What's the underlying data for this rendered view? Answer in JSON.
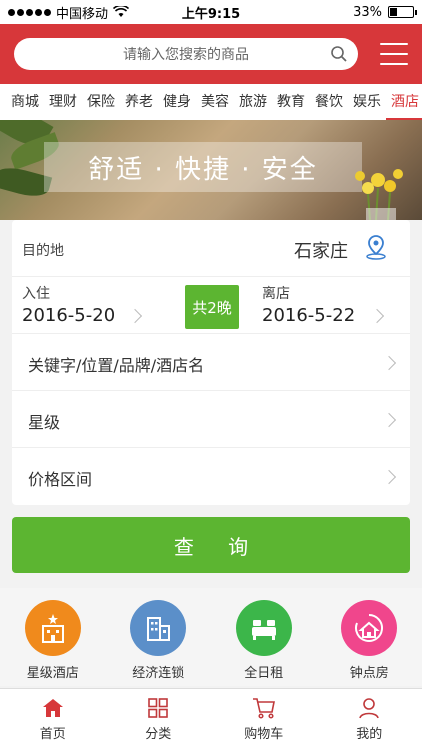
{
  "status": {
    "carrier": "中国移动",
    "time": "上午9:15",
    "battery": "33%"
  },
  "header": {
    "search_placeholder": "请输入您搜索的商品"
  },
  "categories": [
    "商城",
    "理财",
    "保险",
    "养老",
    "健身",
    "美容",
    "旅游",
    "教育",
    "餐饮",
    "娱乐",
    "酒店"
  ],
  "active_category": "酒店",
  "banner": {
    "title": "舒适 · 快捷 · 安全"
  },
  "form": {
    "destination_label": "目的地",
    "destination_value": "石家庄",
    "checkin_label": "入住",
    "checkin_date": "2016-5-20",
    "nights": "共2晚",
    "checkout_label": "离店",
    "checkout_date": "2016-5-22",
    "keyword_label": "关键字/位置/品牌/酒店名",
    "star_label": "星级",
    "price_label": "价格区间"
  },
  "query_button": "查 询",
  "quick": [
    {
      "label": "星级酒店",
      "icon": "hotel-building-icon",
      "color": "#f08a1c"
    },
    {
      "label": "经济连锁",
      "icon": "chain-building-icon",
      "color": "#5b8fc9"
    },
    {
      "label": "全日租",
      "icon": "bed-icon",
      "color": "#3cb64a"
    },
    {
      "label": "钟点房",
      "icon": "clock-house-icon",
      "color": "#f0468c"
    }
  ],
  "tabs": [
    {
      "label": "首页",
      "icon": "home-icon"
    },
    {
      "label": "分类",
      "icon": "grid-icon"
    },
    {
      "label": "购物车",
      "icon": "cart-icon"
    },
    {
      "label": "我的",
      "icon": "person-icon"
    }
  ],
  "colors": {
    "brand_red": "#d7373a",
    "accent_green": "#5cb531"
  }
}
